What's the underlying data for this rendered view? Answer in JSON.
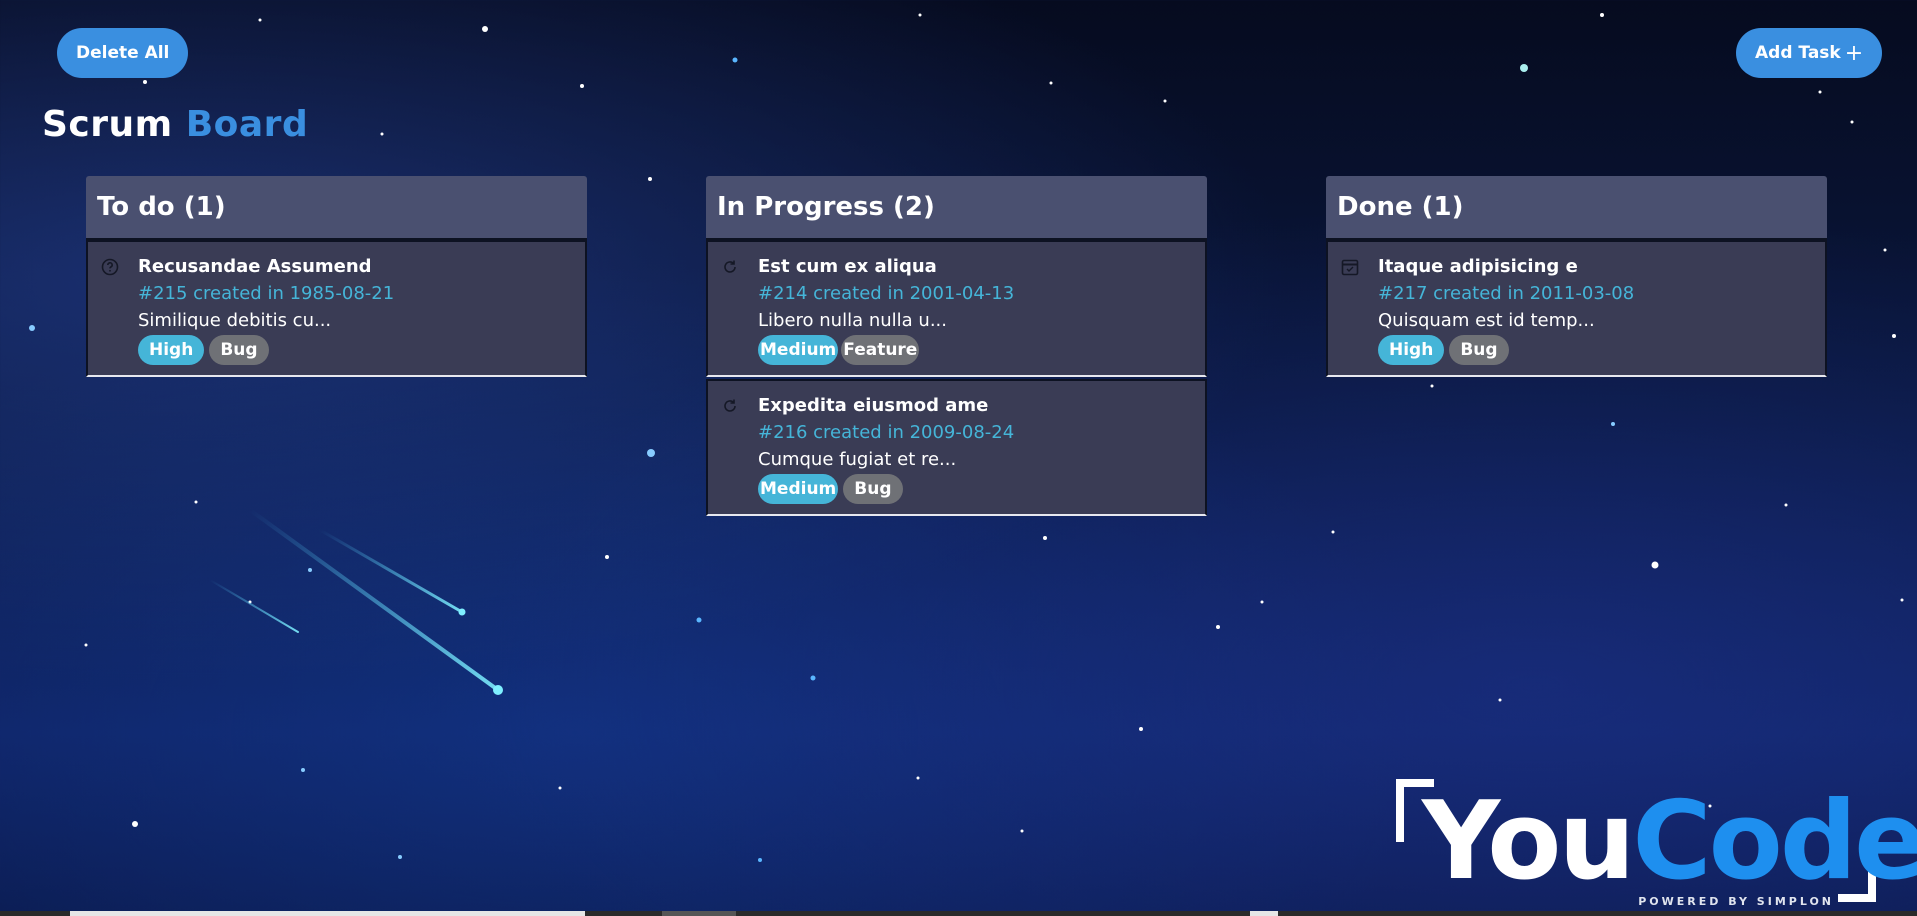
{
  "toolbar": {
    "delete_all_label": "Delete All",
    "add_task_label": "Add Task",
    "add_task_icon": "plus-icon"
  },
  "page_title": {
    "part1": "Scrum",
    "part2": "Board"
  },
  "colors": {
    "accent": "#3a8fe0",
    "header_bg": "#4a5070",
    "card_bg": "#3a3c55",
    "meta_text": "#45b5d8",
    "priority_badge": "#45b5d8",
    "type_badge": "#6f7176"
  },
  "columns": [
    {
      "title": "To do (1)",
      "cards": [
        {
          "icon": "question-circle-icon",
          "title": "Recusandae Assumend",
          "meta": "#215 created in 1985-08-21",
          "description": "Similique debitis cu...",
          "priority": "High",
          "type": "Bug"
        }
      ]
    },
    {
      "title": "In Progress (2)",
      "cards": [
        {
          "icon": "refresh-icon",
          "title": "Est cum ex aliqua",
          "meta": "#214 created in 2001-04-13",
          "description": "Libero nulla nulla u...",
          "priority": "Medium",
          "type": "Feature"
        },
        {
          "icon": "refresh-icon",
          "title": "Expedita eiusmod ame",
          "meta": "#216 created in 2009-08-24",
          "description": "Cumque fugiat et re...",
          "priority": "Medium",
          "type": "Bug"
        }
      ]
    },
    {
      "title": "Done (1)",
      "cards": [
        {
          "icon": "calendar-check-icon",
          "title": "Itaque adipisicing e",
          "meta": "#217 created in 2011-03-08",
          "description": "Quisquam est id temp...",
          "priority": "High",
          "type": "Bug"
        }
      ]
    }
  ],
  "logo": {
    "you": "You",
    "code": "Code",
    "powered": "POWERED BY SIMPLON"
  }
}
